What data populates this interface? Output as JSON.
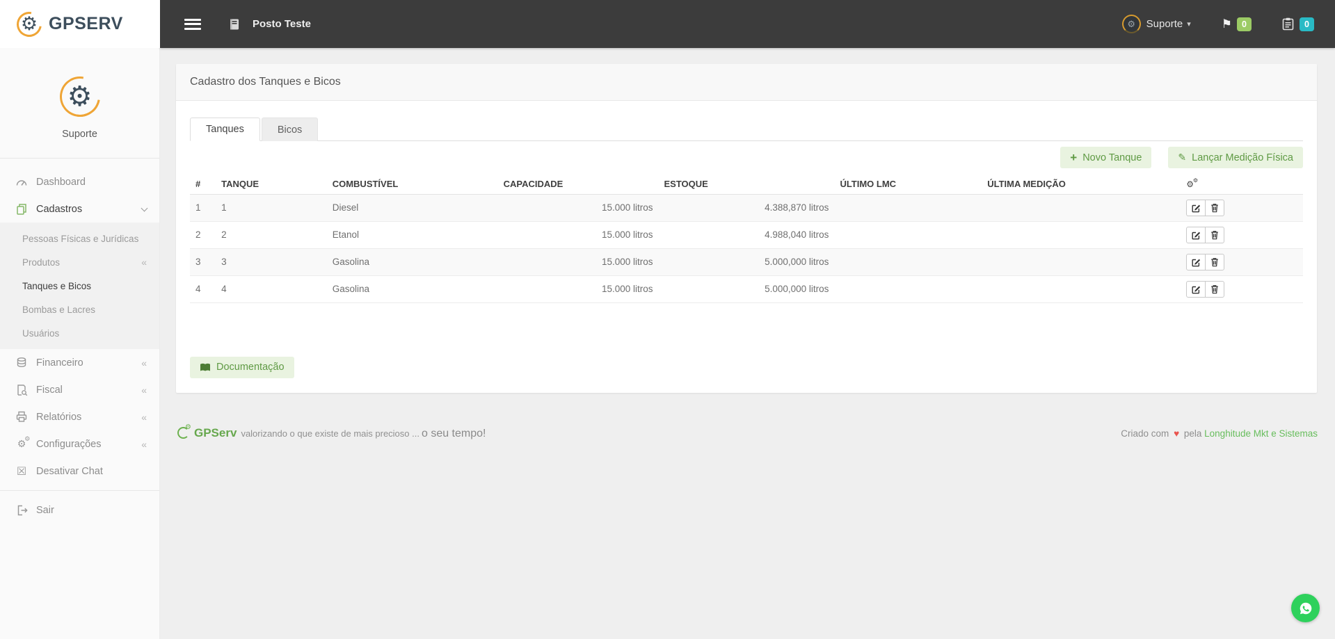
{
  "logo": {
    "text": "GPSERV"
  },
  "topbar": {
    "station_name": "Posto Teste",
    "user_name": "Suporte",
    "flag_badge_count": "0",
    "calendar_badge_count": "0"
  },
  "sidebar": {
    "user_name": "Suporte",
    "items": {
      "dashboard": "Dashboard",
      "cadastros": "Cadastros",
      "financeiro": "Financeiro",
      "fiscal": "Fiscal",
      "relatorios": "Relatórios",
      "configuracoes": "Configurações",
      "desativar_chat": "Desativar Chat",
      "sair": "Sair"
    },
    "cadastros_submenu": [
      {
        "label": "Pessoas Físicas e Jurídicas"
      },
      {
        "label": "Produtos"
      },
      {
        "label": "Tanques e Bicos",
        "active": true
      },
      {
        "label": "Bombas e Lacres"
      },
      {
        "label": "Usuários"
      }
    ]
  },
  "page": {
    "card_title": "Cadastro dos Tanques e Bicos",
    "tabs": {
      "tanques": "Tanques",
      "bicos": "Bicos"
    },
    "buttons": {
      "new_tank": "Novo Tanque",
      "physical_measurement": "Lançar Medição Física",
      "documentation": "Documentação"
    }
  },
  "table": {
    "headers": [
      "#",
      "TANQUE",
      "COMBUSTÍVEL",
      "CAPACIDADE",
      "ESTOQUE",
      "ÚLTIMO LMC",
      "ÚLTIMA MEDIÇÃO"
    ],
    "rows": [
      {
        "num": "1",
        "tanque": "1",
        "combustivel": "Diesel",
        "capacidade": "15.000 litros",
        "estoque": "4.388,870 litros",
        "ultimo_lmc": "",
        "ultima_medicao": ""
      },
      {
        "num": "2",
        "tanque": "2",
        "combustivel": "Etanol",
        "capacidade": "15.000 litros",
        "estoque": "4.988,040 litros",
        "ultimo_lmc": "",
        "ultima_medicao": ""
      },
      {
        "num": "3",
        "tanque": "3",
        "combustivel": "Gasolina",
        "capacidade": "15.000 litros",
        "estoque": "5.000,000 litros",
        "ultimo_lmc": "",
        "ultima_medicao": ""
      },
      {
        "num": "4",
        "tanque": "4",
        "combustivel": "Gasolina",
        "capacidade": "15.000 litros",
        "estoque": "5.000,000 litros",
        "ultimo_lmc": "",
        "ultima_medicao": ""
      }
    ]
  },
  "footer": {
    "brand": "GPServ",
    "tagline": "valorizando o que existe de mais precioso ... ",
    "tagline_emphasis": "o seu tempo!",
    "credit_prefix": "Criado com",
    "credit_middle": "pela",
    "credit_link": "Longhitude Mkt e Sistemas"
  },
  "icons": {
    "gear": "⚙",
    "flag": "⚑",
    "caret_down": "▾",
    "collapse_left": "«",
    "close_box": "☒",
    "plus": "+",
    "pencil": "✎",
    "heart": "♥"
  },
  "colors": {
    "topbar_bg": "#3c3c3c",
    "brand_navy": "#3d4e5c",
    "brand_orange": "#efa536",
    "accent_green_bg": "#e9f3e0",
    "accent_green_text": "#5f9a44",
    "badge_green": "#9ccb65",
    "badge_teal": "#29bac5",
    "footer_link_green": "#67bd5c",
    "heart_red": "#e9544e",
    "whatsapp_green": "#2ed15c"
  }
}
